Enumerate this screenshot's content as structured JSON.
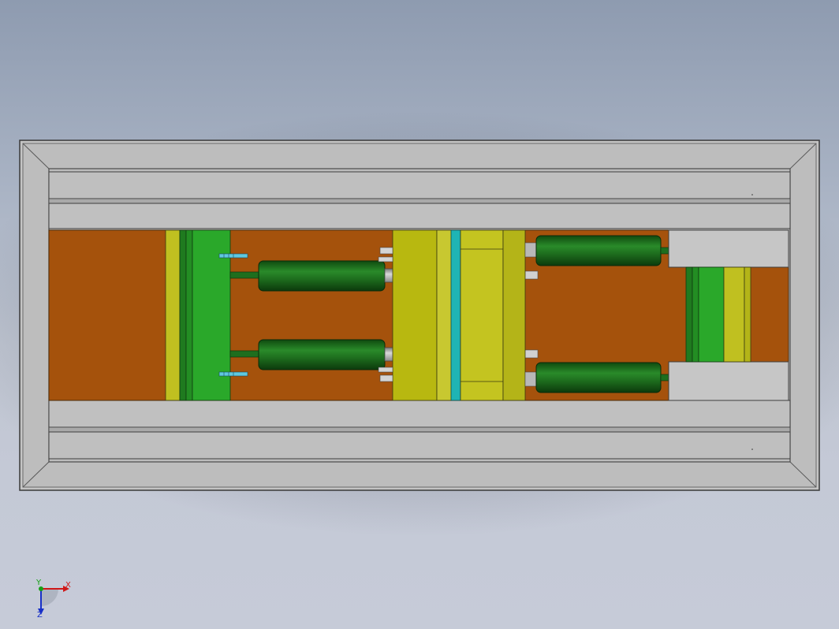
{
  "viewport": {
    "background_top": "#8e9bb0",
    "background_bottom": "#c6cbd8"
  },
  "model": {
    "frame_color": "#bdbdbd",
    "frame_edge": "#4a4a4a",
    "mold_base_color": "#a5520c",
    "plate_yellow": "#b8b810",
    "plate_light_yellow": "#c8c830",
    "plate_green": "#2aa82a",
    "plate_dark_green": "#1f7a1f",
    "cylinder_color": "#1e6e1e",
    "rod_color": "#a8a8a8",
    "cyan_strip": "#1fb4b4",
    "bolt_color": "#5fc8e0"
  },
  "triad": {
    "x_label": "X",
    "y_label": "Y",
    "z_label": "Z",
    "x_color": "#d01818",
    "y_color": "#18a018",
    "z_color": "#1830c8"
  }
}
